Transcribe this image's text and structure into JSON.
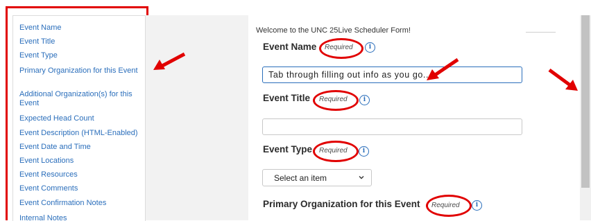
{
  "nav": {
    "items": [
      "Event Name",
      "Event Title",
      "Event Type",
      "Primary Organization for this Event",
      "Additional Organization(s) for this Event",
      "Expected Head Count",
      "Event Description (HTML-Enabled)",
      "Event Date and Time",
      "Event Locations",
      "Event Resources",
      "Event Comments",
      "Event Confirmation Notes"
    ],
    "cutoff_item": "Internal Notes"
  },
  "form": {
    "welcome": "Welcome to the UNC 25Live Scheduler Form!",
    "required_text": "Required",
    "info_glyph": "i",
    "event_name": {
      "label": "Event Name",
      "value": "Tab through filling out info as you go..."
    },
    "event_title": {
      "label": "Event Title",
      "value": ""
    },
    "event_type": {
      "label": "Event Type",
      "selected": "Select an item"
    },
    "primary_org": {
      "label": "Primary Organization for this Event"
    }
  },
  "annotations": {
    "highlight_color": "#e10000"
  },
  "colors": {
    "link": "#2a6ebb",
    "panel_gray": "#f2f2f2"
  }
}
